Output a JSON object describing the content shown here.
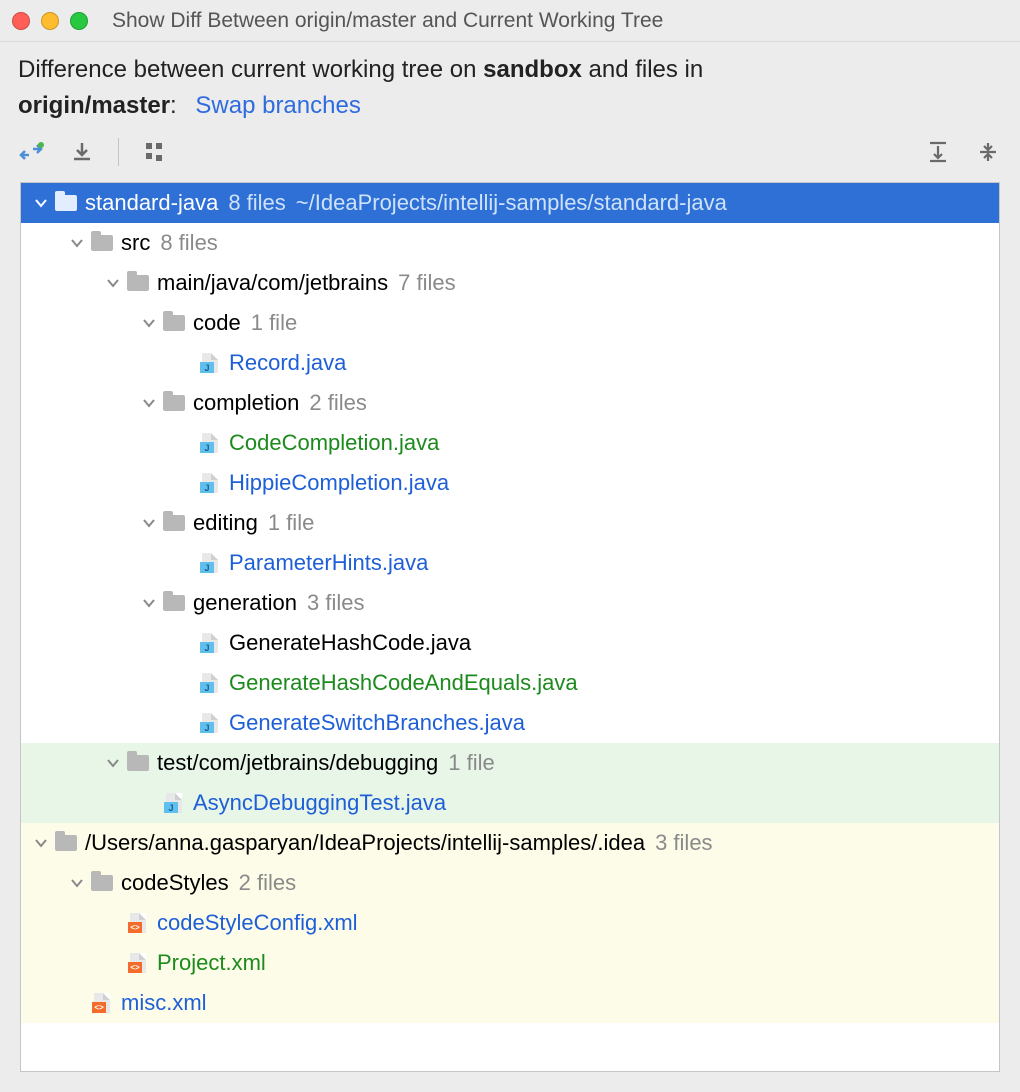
{
  "window": {
    "title": "Show Diff Between origin/master and Current Working Tree"
  },
  "header": {
    "prefix": "Difference between current working tree on ",
    "branch1": "sandbox",
    "middle": " and files in ",
    "branch2": "origin/master",
    "colon": ":",
    "swap_label": "Swap branches"
  },
  "tree": [
    {
      "indent": 0,
      "chev": true,
      "icon": "folder-blue",
      "label": "standard-java",
      "count": "8 files",
      "path": "~/IdeaProjects/intellij-samples/standard-java",
      "selected": true,
      "color": "",
      "bg": ""
    },
    {
      "indent": 1,
      "chev": true,
      "icon": "folder",
      "label": "src",
      "count": "8 files",
      "path": "",
      "selected": false,
      "color": "",
      "bg": ""
    },
    {
      "indent": 2,
      "chev": true,
      "icon": "folder",
      "label": "main/java/com/jetbrains",
      "count": "7 files",
      "path": "",
      "selected": false,
      "color": "",
      "bg": ""
    },
    {
      "indent": 3,
      "chev": true,
      "icon": "folder",
      "label": "code",
      "count": "1 file",
      "path": "",
      "selected": false,
      "color": "",
      "bg": ""
    },
    {
      "indent": 4,
      "chev": false,
      "icon": "java",
      "label": "Record.java",
      "count": "",
      "path": "",
      "selected": false,
      "color": "blue",
      "bg": ""
    },
    {
      "indent": 3,
      "chev": true,
      "icon": "folder",
      "label": "completion",
      "count": "2 files",
      "path": "",
      "selected": false,
      "color": "",
      "bg": ""
    },
    {
      "indent": 4,
      "chev": false,
      "icon": "java",
      "label": "CodeCompletion.java",
      "count": "",
      "path": "",
      "selected": false,
      "color": "green",
      "bg": ""
    },
    {
      "indent": 4,
      "chev": false,
      "icon": "java",
      "label": "HippieCompletion.java",
      "count": "",
      "path": "",
      "selected": false,
      "color": "blue",
      "bg": ""
    },
    {
      "indent": 3,
      "chev": true,
      "icon": "folder",
      "label": "editing",
      "count": "1 file",
      "path": "",
      "selected": false,
      "color": "",
      "bg": ""
    },
    {
      "indent": 4,
      "chev": false,
      "icon": "java",
      "label": "ParameterHints.java",
      "count": "",
      "path": "",
      "selected": false,
      "color": "blue",
      "bg": ""
    },
    {
      "indent": 3,
      "chev": true,
      "icon": "folder",
      "label": "generation",
      "count": "3 files",
      "path": "",
      "selected": false,
      "color": "",
      "bg": ""
    },
    {
      "indent": 4,
      "chev": false,
      "icon": "java",
      "label": "GenerateHashCode.java",
      "count": "",
      "path": "",
      "selected": false,
      "color": "",
      "bg": ""
    },
    {
      "indent": 4,
      "chev": false,
      "icon": "java",
      "label": "GenerateHashCodeAndEquals.java",
      "count": "",
      "path": "",
      "selected": false,
      "color": "green",
      "bg": ""
    },
    {
      "indent": 4,
      "chev": false,
      "icon": "java",
      "label": "GenerateSwitchBranches.java",
      "count": "",
      "path": "",
      "selected": false,
      "color": "blue",
      "bg": ""
    },
    {
      "indent": 2,
      "chev": true,
      "icon": "folder",
      "label": "test/com/jetbrains/debugging",
      "count": "1 file",
      "path": "",
      "selected": false,
      "color": "",
      "bg": "green"
    },
    {
      "indent": 3,
      "chev": false,
      "icon": "java",
      "label": "AsyncDebuggingTest.java",
      "count": "",
      "path": "",
      "selected": false,
      "color": "blue",
      "bg": "green"
    },
    {
      "indent": 0,
      "chev": true,
      "icon": "folder",
      "label": "/Users/anna.gasparyan/IdeaProjects/intellij-samples/.idea",
      "count": "3 files",
      "path": "",
      "selected": false,
      "color": "",
      "bg": "yellow"
    },
    {
      "indent": 1,
      "chev": true,
      "icon": "folder",
      "label": "codeStyles",
      "count": "2 files",
      "path": "",
      "selected": false,
      "color": "",
      "bg": "yellow"
    },
    {
      "indent": 2,
      "chev": false,
      "icon": "xml",
      "label": "codeStyleConfig.xml",
      "count": "",
      "path": "",
      "selected": false,
      "color": "blue",
      "bg": "yellow"
    },
    {
      "indent": 2,
      "chev": false,
      "icon": "xml",
      "label": "Project.xml",
      "count": "",
      "path": "",
      "selected": false,
      "color": "green",
      "bg": "yellow"
    },
    {
      "indent": 1,
      "chev": false,
      "icon": "xml",
      "label": "misc.xml",
      "count": "",
      "path": "",
      "selected": false,
      "color": "blue",
      "bg": "yellow"
    }
  ]
}
